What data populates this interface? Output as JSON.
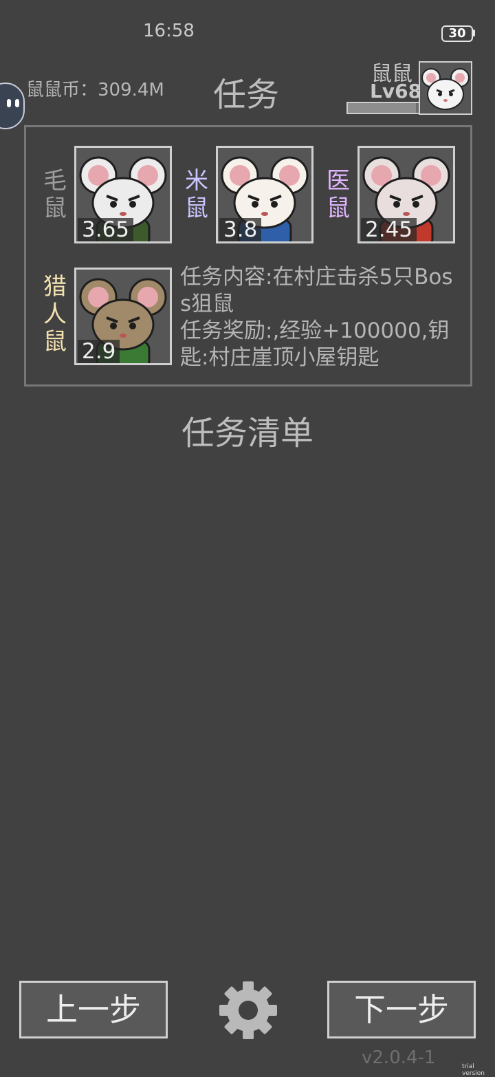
{
  "status_bar": {
    "time": "16:58",
    "battery": "30"
  },
  "header": {
    "coin_label": "鼠鼠币：309.4M",
    "title": "任务",
    "player_name": "鼠鼠",
    "player_level": "Lv68",
    "exp_progress": 0.95
  },
  "team": [
    {
      "name": "毛鼠",
      "power": "3.65",
      "name_color": "#9e9e9e",
      "fur": "#ececec",
      "outfit": "#3c5a2c"
    },
    {
      "name": "米鼠",
      "power": "3.8",
      "name_color": "#c9c6ff",
      "fur": "#f6f1ea",
      "outfit": "#2f5fa8"
    },
    {
      "name": "医鼠",
      "power": "2.45",
      "name_color": "#e2b6ff",
      "fur": "#e9dede",
      "outfit": "#c0392b"
    },
    {
      "name": "猎人鼠",
      "power": "2.9",
      "name_color": "#f3e2b0",
      "fur": "#a08a6a",
      "outfit": "#3b7a34"
    }
  ],
  "task": {
    "content": "任务内容:在村庄击杀5只Boss狙鼠",
    "reward": "任务奖励:,经验+100000,钥匙:村庄崖顶小屋钥匙"
  },
  "list_title": "任务清单",
  "buttons": {
    "prev": "上一步",
    "next": "下一步"
  },
  "icons": {
    "settings": "gear-icon"
  },
  "version": "v2.0.4-1",
  "watermark": "trial version"
}
